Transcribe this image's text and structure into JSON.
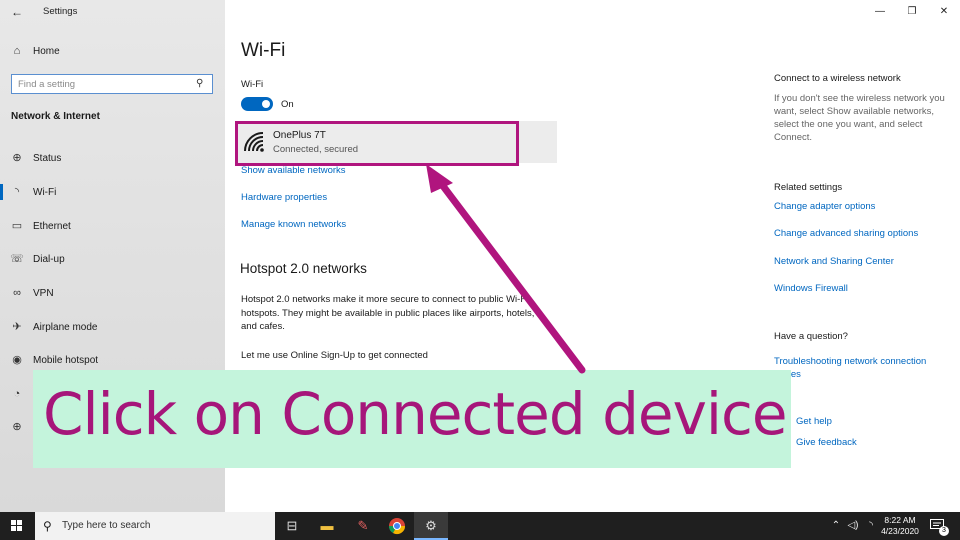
{
  "window": {
    "app_title": "Settings",
    "controls": {
      "minimize": "—",
      "restore": "❐",
      "close": "✕"
    }
  },
  "sidebar": {
    "back_icon": "←",
    "home_label": "Home",
    "home_icon": "⌂",
    "search_placeholder": "Find a setting",
    "search_icon": "⚲",
    "section_title": "Network & Internet",
    "items": [
      {
        "label": "Status",
        "icon": "⊕",
        "active": false
      },
      {
        "label": "Wi-Fi",
        "icon": "◝",
        "active": true
      },
      {
        "label": "Ethernet",
        "icon": "▭",
        "active": false
      },
      {
        "label": "Dial-up",
        "icon": "☏",
        "active": false
      },
      {
        "label": "VPN",
        "icon": "∞",
        "active": false
      },
      {
        "label": "Airplane mode",
        "icon": "✈",
        "active": false
      },
      {
        "label": "Mobile hotspot",
        "icon": "◉",
        "active": false
      },
      {
        "label": "",
        "icon": "◔",
        "active": false
      },
      {
        "label": "",
        "icon": "⊕",
        "active": false
      }
    ]
  },
  "main": {
    "title": "Wi-Fi",
    "wifi_label": "Wi-Fi",
    "toggle_state": "On",
    "network": {
      "name": "OnePlus 7T",
      "status": "Connected, secured"
    },
    "links": {
      "show_networks": "Show available networks",
      "hardware": "Hardware properties",
      "manage": "Manage known networks"
    },
    "hotspot_heading": "Hotspot 2.0 networks",
    "hotspot_text": "Hotspot 2.0 networks make it more secure to connect to public Wi-Fi hotspots. They might be available in public places like airports, hotels, and cafes.",
    "online_signup": "Let me use Online Sign-Up to get connected"
  },
  "right": {
    "connect_heading": "Connect to a wireless network",
    "connect_text": "If you don't see the wireless network you want, select Show available networks, select the one you want, and select Connect.",
    "related_heading": "Related settings",
    "related_links": [
      "Change adapter options",
      "Change advanced sharing options",
      "Network and Sharing Center",
      "Windows Firewall"
    ],
    "question_heading": "Have a question?",
    "troubleshoot_line1": "Troubleshooting network connection",
    "troubleshoot_line2": "issues",
    "get_help": "Get help",
    "feedback": "Give feedback"
  },
  "overlay": {
    "banner_text": "Click on Connected device",
    "highlight_color": "#b0157e",
    "banner_bg": "#c4f4dc"
  },
  "taskbar": {
    "search_placeholder": "Type here to search",
    "time": "8:22 AM",
    "date": "4/23/2020",
    "notification_count": "3",
    "apps": [
      "task-view-icon",
      "file-explorer-icon",
      "paint-icon",
      "chrome-icon",
      "settings-icon"
    ]
  }
}
